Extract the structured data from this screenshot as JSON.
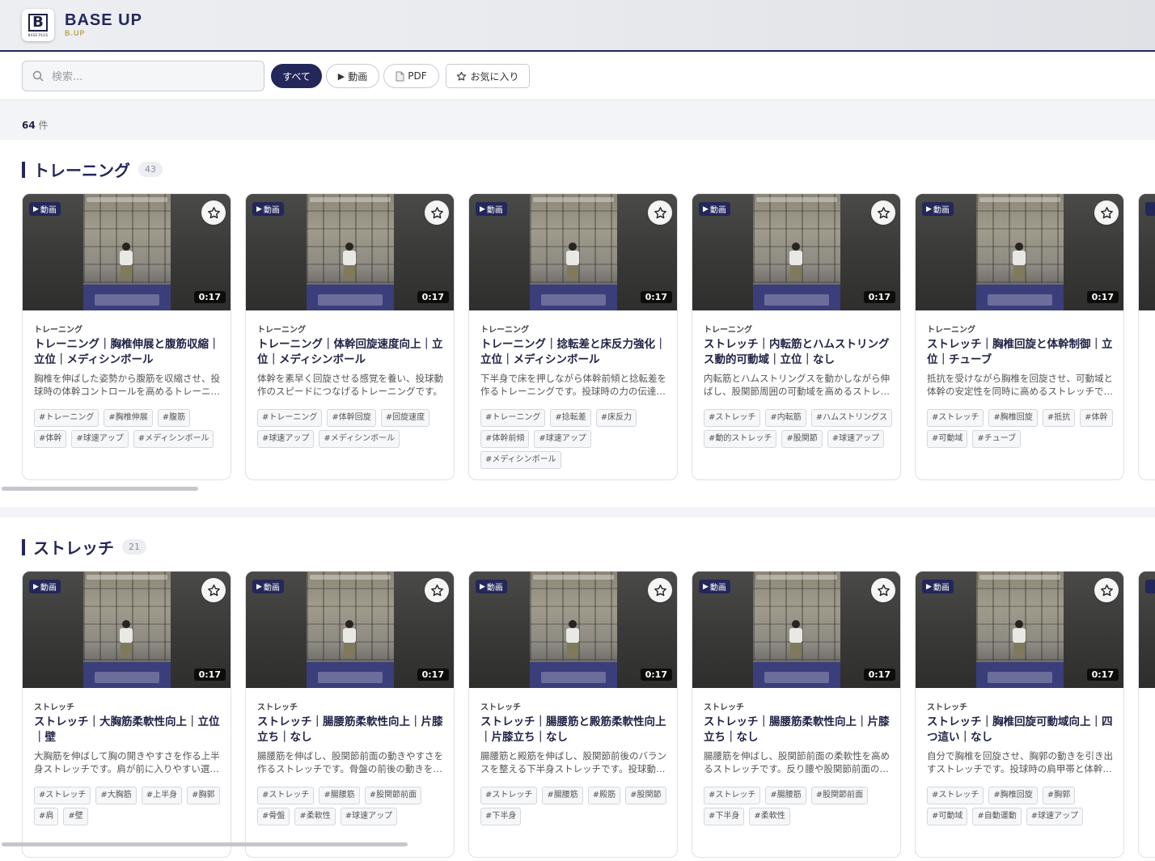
{
  "brand": {
    "title": "BASE UP",
    "subtitle": "B.UP",
    "logo_text": "B",
    "logo_sub": "BASE-PLUS"
  },
  "search": {
    "placeholder": "検索..."
  },
  "filters": {
    "all": "すべて",
    "video": "動画",
    "pdf": "PDF",
    "favorites": "お気に入り"
  },
  "result": {
    "count": "64",
    "unit": "件"
  },
  "colors": {
    "accent": "#24275a",
    "brand_gold": "#b8a84a"
  },
  "sections": [
    {
      "title": "トレーニング",
      "count": "43",
      "cards": [
        {
          "badge": "動画",
          "duration": "0:17",
          "category": "トレーニング",
          "title": "トレーニング｜胸椎伸展と腹筋収縮｜立位｜メディシンボール",
          "desc": "胸椎を伸ばした姿勢から腹筋を収縮させ、投球時の体幹コントロールを高めるトレーニングです。",
          "tags": [
            "#トレーニング",
            "#胸椎伸展",
            "#腹筋",
            "#体幹",
            "#球速アップ",
            "#メディシンボール"
          ]
        },
        {
          "badge": "動画",
          "duration": "0:17",
          "category": "トレーニング",
          "title": "トレーニング｜体幹回旋速度向上｜立位｜メディシンボール",
          "desc": "体幹を素早く回旋させる感覚を養い、投球動作のスピードにつなげるトレーニングです。",
          "tags": [
            "#トレーニング",
            "#体幹回旋",
            "#回旋速度",
            "#球速アップ",
            "#メディシンボール"
          ]
        },
        {
          "badge": "動画",
          "duration": "0:17",
          "category": "トレーニング",
          "title": "トレーニング｜捻転差と床反力強化｜立位｜メディシンボール",
          "desc": "下半身で床を押しながら体幹前傾と捻転差を作るトレーニングです。投球時の力の伝達を高めます。",
          "tags": [
            "#トレーニング",
            "#捻転差",
            "#床反力",
            "#体幹前傾",
            "#球速アップ",
            "#メディシンボール"
          ]
        },
        {
          "badge": "動画",
          "duration": "0:17",
          "category": "トレーニング",
          "title": "ストレッチ｜内転筋とハムストリングス動的可動域｜立位｜なし",
          "desc": "内転筋とハムストリングスを動かしながら伸ばし、股関節周囲の可動域を高めるストレッチです。",
          "tags": [
            "#ストレッチ",
            "#内転筋",
            "#ハムストリングス",
            "#動的ストレッチ",
            "#股関節",
            "#球速アップ"
          ]
        },
        {
          "badge": "動画",
          "duration": "0:17",
          "category": "トレーニング",
          "title": "ストレッチ｜胸椎回旋と体幹制御｜立位｜チューブ",
          "desc": "抵抗を受けながら胸椎を回旋させ、可動域と体幹の安定性を同時に高めるストレッチです。",
          "tags": [
            "#ストレッチ",
            "#胸椎回旋",
            "#抵抗",
            "#体幹",
            "#可動域",
            "#チューブ"
          ]
        }
      ]
    },
    {
      "title": "ストレッチ",
      "count": "21",
      "cards": [
        {
          "badge": "動画",
          "duration": "0:17",
          "category": "ストレッチ",
          "title": "ストレッチ｜大胸筋柔軟性向上｜立位｜壁",
          "desc": "大胸筋を伸ばして胸の開きやすさを作る上半身ストレッチです。肩が前に入りやすい選手におすすめです。",
          "tags": [
            "#ストレッチ",
            "#大胸筋",
            "#上半身",
            "#胸郭",
            "#肩",
            "#壁"
          ]
        },
        {
          "badge": "動画",
          "duration": "0:17",
          "category": "ストレッチ",
          "title": "ストレッチ｜腸腰筋柔軟性向上｜片膝立ち｜なし",
          "desc": "腸腰筋を伸ばし、股関節前面の動きやすさを作るストレッチです。骨盤の前後の動きを整えます。",
          "tags": [
            "#ストレッチ",
            "#腸腰筋",
            "#股関節前面",
            "#骨盤",
            "#柔軟性",
            "#球速アップ"
          ]
        },
        {
          "badge": "動画",
          "duration": "0:17",
          "category": "ストレッチ",
          "title": "ストレッチ｜腸腰筋と殿筋柔軟性向上｜片膝立ち｜なし",
          "desc": "腸腰筋と殿筋を伸ばし、股関節前後のバランスを整える下半身ストレッチです。投球動作を安定させます。",
          "tags": [
            "#ストレッチ",
            "#腸腰筋",
            "#殿筋",
            "#股関節",
            "#下半身"
          ]
        },
        {
          "badge": "動画",
          "duration": "0:17",
          "category": "ストレッチ",
          "title": "ストレッチ｜腸腰筋柔軟性向上｜片膝立ち｜なし",
          "desc": "腸腰筋を伸ばし、股関節前面の柔軟性を高めるストレッチです。反り腰や股関節前面の張りに有効です。",
          "tags": [
            "#ストレッチ",
            "#腸腰筋",
            "#股関節前面",
            "#下半身",
            "#柔軟性"
          ]
        },
        {
          "badge": "動画",
          "duration": "0:17",
          "category": "ストレッチ",
          "title": "ストレッチ｜胸椎回旋可動域向上｜四つ這い｜なし",
          "desc": "自分で胸椎を回旋させ、胸郭の動きを引き出すストレッチです。投球時の肩甲帯と体幹の連動を高めます。",
          "tags": [
            "#ストレッチ",
            "#胸椎回旋",
            "#胸郭",
            "#可動域",
            "#自動運動",
            "#球速アップ"
          ]
        }
      ]
    }
  ]
}
